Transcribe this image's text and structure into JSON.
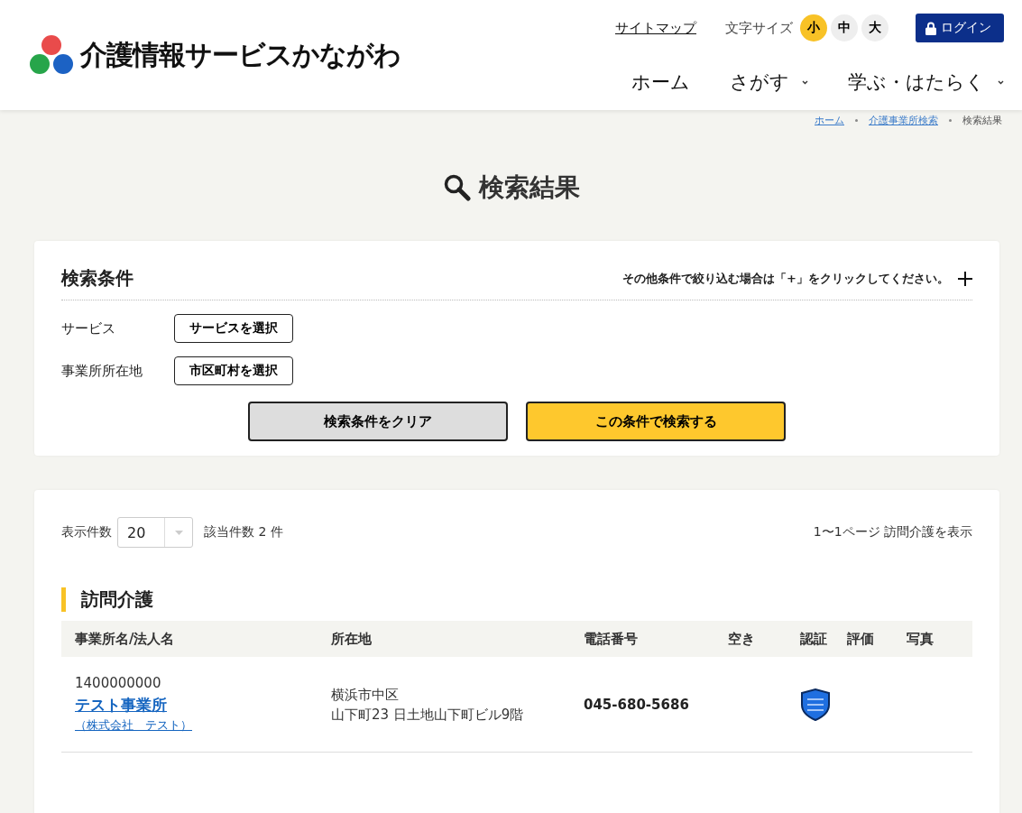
{
  "header": {
    "site_name": "介護情報サービスかながわ",
    "sitemap": "サイトマップ",
    "font_size_label": "文字サイズ",
    "font_sizes": [
      {
        "label": "小",
        "selected": true
      },
      {
        "label": "中",
        "selected": false
      },
      {
        "label": "大",
        "selected": false
      }
    ],
    "login": "ログイン",
    "nav": [
      {
        "label": "ホーム",
        "dropdown": false
      },
      {
        "label": "さがす",
        "dropdown": true
      },
      {
        "label": "学ぶ・はたらく",
        "dropdown": true
      }
    ]
  },
  "breadcrumb": [
    "ホーム",
    "介護事業所検索",
    "検索結果"
  ],
  "page_title": "検索結果",
  "search_conditions": {
    "title": "検索条件",
    "hint": "その他条件で絞り込む場合は「+」をクリックしてください。",
    "fields": [
      {
        "label": "サービス",
        "button": "サービスを選択"
      },
      {
        "label": "事業所所在地",
        "button": "市区町村を選択"
      }
    ],
    "clear_button": "検索条件をクリア",
    "search_button": "この条件で検索する"
  },
  "results": {
    "per_page_label": "表示件数",
    "per_page": "20",
    "count": "該当件数 2 件",
    "pages": "1〜1ページ 訪問介護を表示",
    "section_title": "訪問介護",
    "columns": [
      "事業所名/法人名",
      "所在地",
      "電話番号",
      "空き",
      "認証",
      "評価",
      "写真"
    ],
    "rows": [
      {
        "id": "1400000000",
        "name": "テスト事業所",
        "corp": "（株式会社　テスト）",
        "address": [
          "横浜市中区",
          "山下町23 日土地山下町ビル9階"
        ],
        "phone": "045-680-5686",
        "certified": true
      }
    ]
  }
}
